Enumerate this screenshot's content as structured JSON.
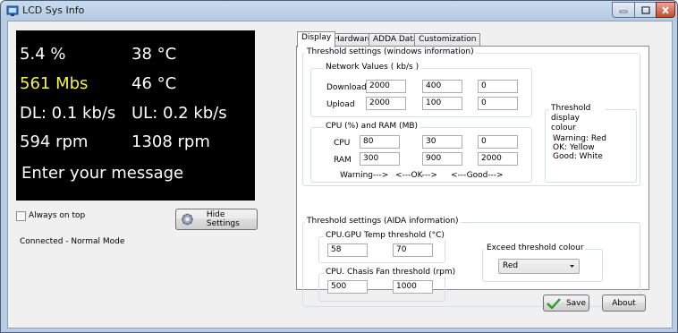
{
  "window": {
    "title": "LCD Sys Info"
  },
  "lcd": {
    "rows": [
      {
        "left": "5.4 %",
        "right": "38 °C",
        "left_color": "#ffffff"
      },
      {
        "left": "561 Mbs",
        "right": "46 °C",
        "left_color": "#f5f542"
      },
      {
        "left": "DL: 0.1 kb/s",
        "right": "UL: 0.2 kb/s",
        "left_color": "#ffffff"
      },
      {
        "left": "594 rpm",
        "right": "1308 rpm",
        "left_color": "#ffffff"
      }
    ],
    "message": "Enter your message"
  },
  "always_on_top": {
    "label": "Always on top",
    "checked": false
  },
  "hide_settings_label": "Hide Settings",
  "status_text": "Connected - Normal Mode",
  "tabs": [
    "Display",
    "Hardware",
    "ADDA Data",
    "Customization"
  ],
  "active_tab": "Display",
  "windows_thresholds": {
    "title": "Threshold settings (windows information)",
    "network": {
      "title": "Network Values ( kb/s )",
      "download_label": "Download",
      "download": [
        "2000",
        "400",
        "0"
      ],
      "upload_label": "Upload",
      "upload": [
        "2000",
        "100",
        "0"
      ]
    },
    "cpu_ram": {
      "title": "CPU (%) and RAM (MB)",
      "cpu_label": "CPU",
      "cpu": [
        "80",
        "30",
        "0"
      ],
      "ram_label": "RAM",
      "ram": [
        "300",
        "900",
        "2000"
      ],
      "legend": [
        "Warning--->",
        "<---OK--->",
        "<---Good--->"
      ]
    },
    "display_colour": {
      "title": "Threshold display colour",
      "lines": [
        "Warning: Red",
        "OK: Yellow",
        "Good: White"
      ]
    }
  },
  "aida_thresholds": {
    "title": "Threshold settings (AIDA information)",
    "temp": {
      "title": "CPU.GPU Temp threshold (°C)",
      "values": [
        "58",
        "70"
      ]
    },
    "fan": {
      "title": "CPU. Chasis Fan threshold (rpm)",
      "values": [
        "500",
        "1000"
      ]
    },
    "exceed": {
      "title": "Exceed threshold colour",
      "selected": "Red"
    }
  },
  "buttons": {
    "save": "Save",
    "about": "About"
  },
  "colors": {
    "lcd_bg": "#000000",
    "warning_yellow": "#f5f542",
    "save_check": "#2e9a2e"
  }
}
